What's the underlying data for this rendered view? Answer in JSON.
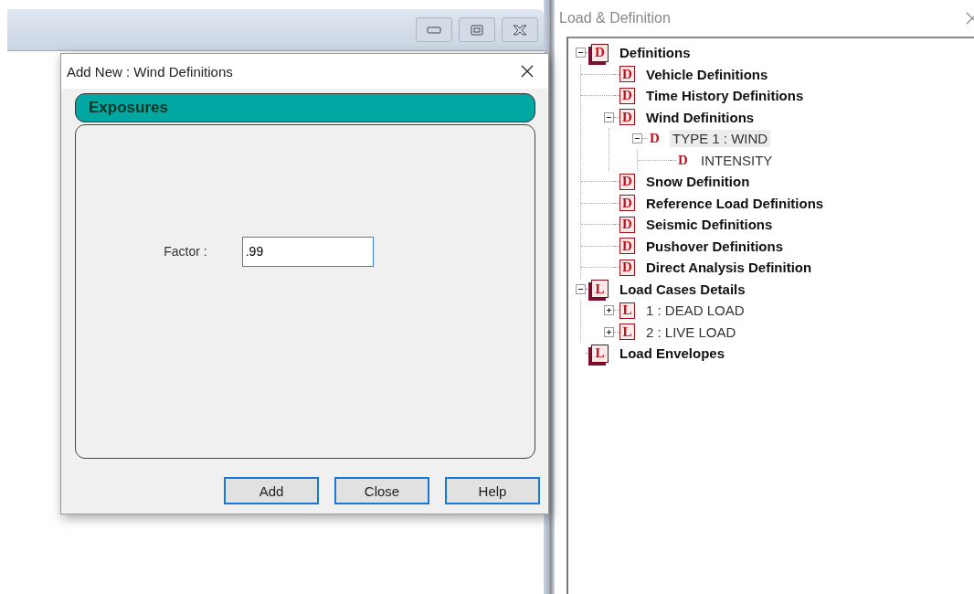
{
  "dialog": {
    "title": "Add New : Wind Definitions",
    "section": "Exposures",
    "field": {
      "label": "Factor :",
      "value": ".99"
    },
    "buttons": [
      "Add",
      "Close",
      "Help"
    ]
  },
  "panel": {
    "title": "Load & Definition",
    "tree": [
      {
        "letter": "D",
        "kind": "root",
        "label": "Definitions",
        "selected": false,
        "expanded": true,
        "children": [
          {
            "letter": "D",
            "kind": "category",
            "label": "Vehicle Definitions",
            "selected": false
          },
          {
            "letter": "D",
            "kind": "category",
            "label": "Time History Definitions",
            "selected": false
          },
          {
            "letter": "D",
            "kind": "category",
            "label": "Wind Definitions",
            "selected": false,
            "expanded": true,
            "children": [
              {
                "letter": "D",
                "kind": "entry",
                "label": "TYPE 1 : WIND",
                "selected": true,
                "expanded": true,
                "children": [
                  {
                    "letter": "D",
                    "kind": "entry",
                    "label": "INTENSITY",
                    "selected": false
                  }
                ]
              }
            ]
          },
          {
            "letter": "D",
            "kind": "category",
            "label": "Snow Definition",
            "selected": false
          },
          {
            "letter": "D",
            "kind": "category",
            "label": "Reference Load Definitions",
            "selected": false
          },
          {
            "letter": "D",
            "kind": "category",
            "label": "Seismic Definitions",
            "selected": false
          },
          {
            "letter": "D",
            "kind": "category",
            "label": "Pushover Definitions",
            "selected": false
          },
          {
            "letter": "D",
            "kind": "category",
            "label": "Direct Analysis Definition",
            "selected": false
          }
        ]
      },
      {
        "letter": "L",
        "kind": "root",
        "label": "Load Cases Details",
        "selected": false,
        "expanded": true,
        "children": [
          {
            "letter": "L",
            "kind": "case",
            "label": "1 : DEAD LOAD",
            "selected": false,
            "expanded": false
          },
          {
            "letter": "L",
            "kind": "case",
            "label": "2 : LIVE LOAD",
            "selected": false,
            "expanded": false
          }
        ]
      },
      {
        "letter": "L",
        "kind": "root",
        "label": "Load Envelopes",
        "selected": false
      }
    ]
  }
}
